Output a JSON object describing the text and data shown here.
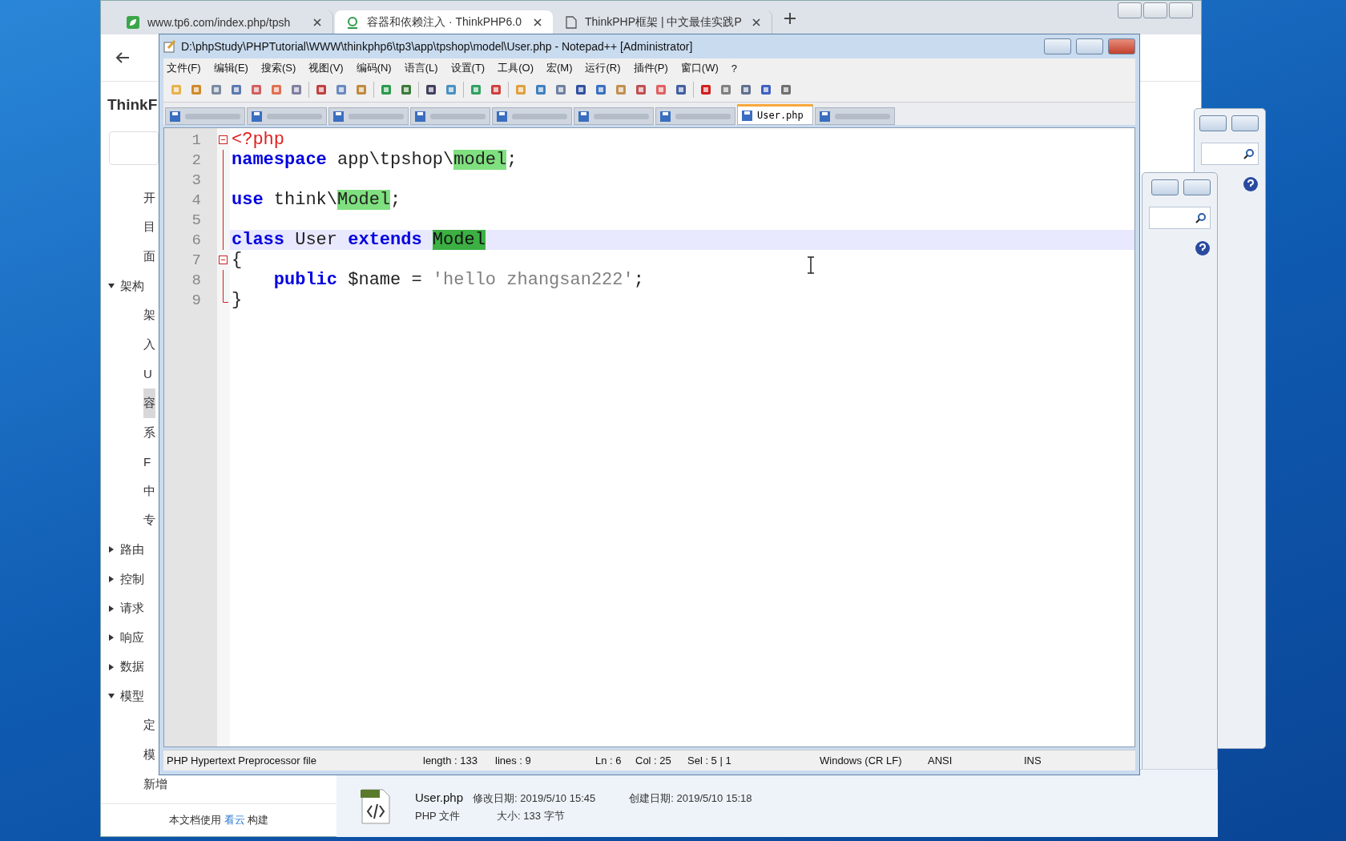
{
  "browser": {
    "tabs": [
      {
        "label": "www.tp6.com/index.php/tpsh",
        "selected": false,
        "kind": "leaf"
      },
      {
        "label": "容器和依赖注入 · ThinkPHP6.0",
        "selected": true,
        "kind": "cloud"
      },
      {
        "label": "ThinkPHP框架 | 中文最佳实践P",
        "selected": false,
        "kind": "page"
      }
    ],
    "page": {
      "brand": "ThinkF",
      "leading_items": [
        {
          "label": "开",
          "selected": false
        },
        {
          "label": "目",
          "selected": false
        },
        {
          "label": "面",
          "selected": false
        }
      ],
      "groups": [
        {
          "label": "架构",
          "expanded": true,
          "children": [
            {
              "label": "架",
              "selected": false
            },
            {
              "label": "入",
              "selected": false
            },
            {
              "label": "U",
              "selected": false
            },
            {
              "label": "容",
              "selected": true
            },
            {
              "label": "系",
              "selected": false
            },
            {
              "label": "F",
              "selected": false
            },
            {
              "label": "中",
              "selected": false
            },
            {
              "label": "专",
              "selected": false
            }
          ]
        },
        {
          "label": "路由",
          "expanded": false
        },
        {
          "label": "控制",
          "expanded": false
        },
        {
          "label": "请求",
          "expanded": false
        },
        {
          "label": "响应",
          "expanded": false
        },
        {
          "label": "数据",
          "expanded": false
        },
        {
          "label": "模型",
          "expanded": true,
          "children": [
            {
              "label": "定",
              "selected": false
            },
            {
              "label": "模",
              "selected": false
            },
            {
              "label": "新增",
              "selected": false
            }
          ]
        }
      ],
      "footer": [
        "本文档使用 ",
        "看云",
        " 构建"
      ]
    }
  },
  "notepad": {
    "title": "D:\\phpStudy\\PHPTutorial\\WWW\\thinkphp6\\tp3\\app\\tpshop\\model\\User.php - Notepad++ [Administrator]",
    "menu": [
      "文件(F)",
      "编辑(E)",
      "搜索(S)",
      "视图(V)",
      "编码(N)",
      "语言(L)",
      "设置(T)",
      "工具(O)",
      "宏(M)",
      "运行(R)",
      "插件(P)",
      "窗口(W)",
      "?"
    ],
    "tabs": [
      {
        "selected": false
      },
      {
        "selected": false
      },
      {
        "selected": false
      },
      {
        "selected": false
      },
      {
        "selected": false
      },
      {
        "selected": false
      },
      {
        "selected": false
      },
      {
        "label": "User.php",
        "selected": true
      },
      {
        "selected": false
      }
    ],
    "lines": [
      {
        "number": "1",
        "fold_open": true,
        "current": false,
        "tokens": [
          {
            "kind": "tag",
            "text": "<?php"
          }
        ]
      },
      {
        "number": "2",
        "current": false,
        "tokens": [
          {
            "kind": "keyword",
            "text": "namespace"
          },
          {
            "kind": "plain",
            "text": " app\\tpshop\\"
          },
          {
            "kind": "match",
            "text": "model"
          },
          {
            "kind": "op",
            "text": ";"
          }
        ]
      },
      {
        "number": "3",
        "current": false
      },
      {
        "number": "4",
        "current": false,
        "tokens": [
          {
            "kind": "keyword",
            "text": "use"
          },
          {
            "kind": "plain",
            "text": " think\\"
          },
          {
            "kind": "match",
            "text": "Model"
          },
          {
            "kind": "op",
            "text": ";"
          }
        ]
      },
      {
        "number": "5",
        "current": false
      },
      {
        "number": "6",
        "current": true,
        "tokens": [
          {
            "kind": "keyword",
            "text": "class"
          },
          {
            "kind": "plain",
            "text": " User "
          },
          {
            "kind": "keyword",
            "text": "extends "
          },
          {
            "kind": "selection",
            "text": "Model"
          }
        ]
      },
      {
        "number": "7",
        "fold_open": true,
        "current": false,
        "tokens": [
          {
            "kind": "op",
            "text": "{"
          }
        ]
      },
      {
        "number": "8",
        "current": false,
        "tokens": [
          {
            "kind": "keyword",
            "text": "    public"
          },
          {
            "kind": "plain",
            "text": " $name "
          },
          {
            "kind": "op",
            "text": "= "
          },
          {
            "kind": "string",
            "text": "'hello zhangsan222'"
          },
          {
            "kind": "op",
            "text": ";"
          }
        ]
      },
      {
        "number": "9",
        "fold_end": true,
        "current": false,
        "tokens": [
          {
            "kind": "op",
            "text": "}"
          }
        ]
      }
    ],
    "status_bar": [
      "PHP Hypertext Preprocessor file",
      "length : 133",
      "lines : 9",
      "Ln : 6",
      "Col : 25",
      "Sel : 5 | 1",
      "Windows (CR LF)",
      "ANSI",
      "INS"
    ]
  },
  "file_details": {
    "name": "User.php",
    "modified": "修改日期: 2019/5/10 15:45",
    "created": "创建日期: 2019/5/10 15:18",
    "type": "PHP 文件",
    "size": "大小: 133 字节"
  }
}
